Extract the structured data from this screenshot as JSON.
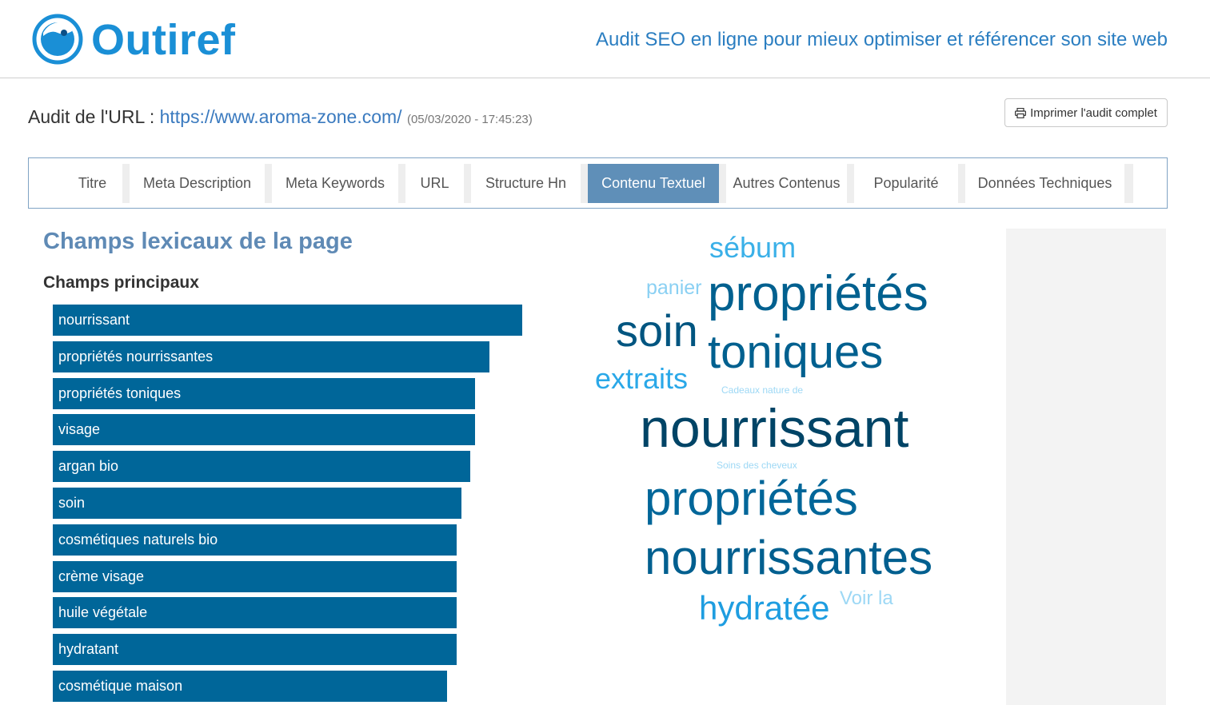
{
  "brand": {
    "name": "Outiref",
    "tagline": "Audit SEO en ligne pour mieux optimiser et référencer son site web",
    "color": "#1a8fd6"
  },
  "audit": {
    "prefix": "Audit de l'URL : ",
    "url": "https://www.aroma-zone.com/",
    "date": "(05/03/2020 - 17:45:23)",
    "print_label": "Imprimer l'audit complet"
  },
  "tabs": [
    {
      "label": "Titre",
      "active": false
    },
    {
      "label": "Meta Description",
      "active": false
    },
    {
      "label": "Meta Keywords",
      "active": false
    },
    {
      "label": "URL",
      "active": false
    },
    {
      "label": "Structure Hn",
      "active": false
    },
    {
      "label": "Contenu Textuel",
      "active": true
    },
    {
      "label": "Autres Contenus",
      "active": false
    },
    {
      "label": "Popularité",
      "active": false
    },
    {
      "label": "Données Techniques",
      "active": false
    }
  ],
  "section": {
    "title": "Champs lexicaux de la page",
    "subtitle": "Champs principaux"
  },
  "chart_data": {
    "type": "bar",
    "orientation": "horizontal",
    "title": "Champs principaux",
    "categories": [
      "nourrissant",
      "propriétés nourrissantes",
      "propriétés toniques",
      "visage",
      "argan bio",
      "soin",
      "cosmétiques naturels bio",
      "crème visage",
      "huile végétale",
      "hydratant",
      "cosmétique maison"
    ],
    "values": [
      100,
      93,
      90,
      90,
      89,
      87,
      86,
      86,
      86,
      86,
      84
    ],
    "xlim": [
      0,
      100
    ],
    "grid": false,
    "color": "#006699"
  },
  "word_cloud": [
    {
      "text": "sébum",
      "weight": 3
    },
    {
      "text": "panier",
      "weight": 2
    },
    {
      "text": "propriétés",
      "weight": 5
    },
    {
      "text": "soin",
      "weight": 5
    },
    {
      "text": "toniques",
      "weight": 5
    },
    {
      "text": "extraits",
      "weight": 3
    },
    {
      "text": "Cadeaux nature de",
      "weight": 1
    },
    {
      "text": "nourrissant",
      "weight": 6
    },
    {
      "text": "Soins des cheveux",
      "weight": 1
    },
    {
      "text": "propriétés",
      "weight": 5
    },
    {
      "text": "nourrissantes",
      "weight": 5
    },
    {
      "text": "hydratée",
      "weight": 4
    },
    {
      "text": "Voir la",
      "weight": 2
    }
  ]
}
